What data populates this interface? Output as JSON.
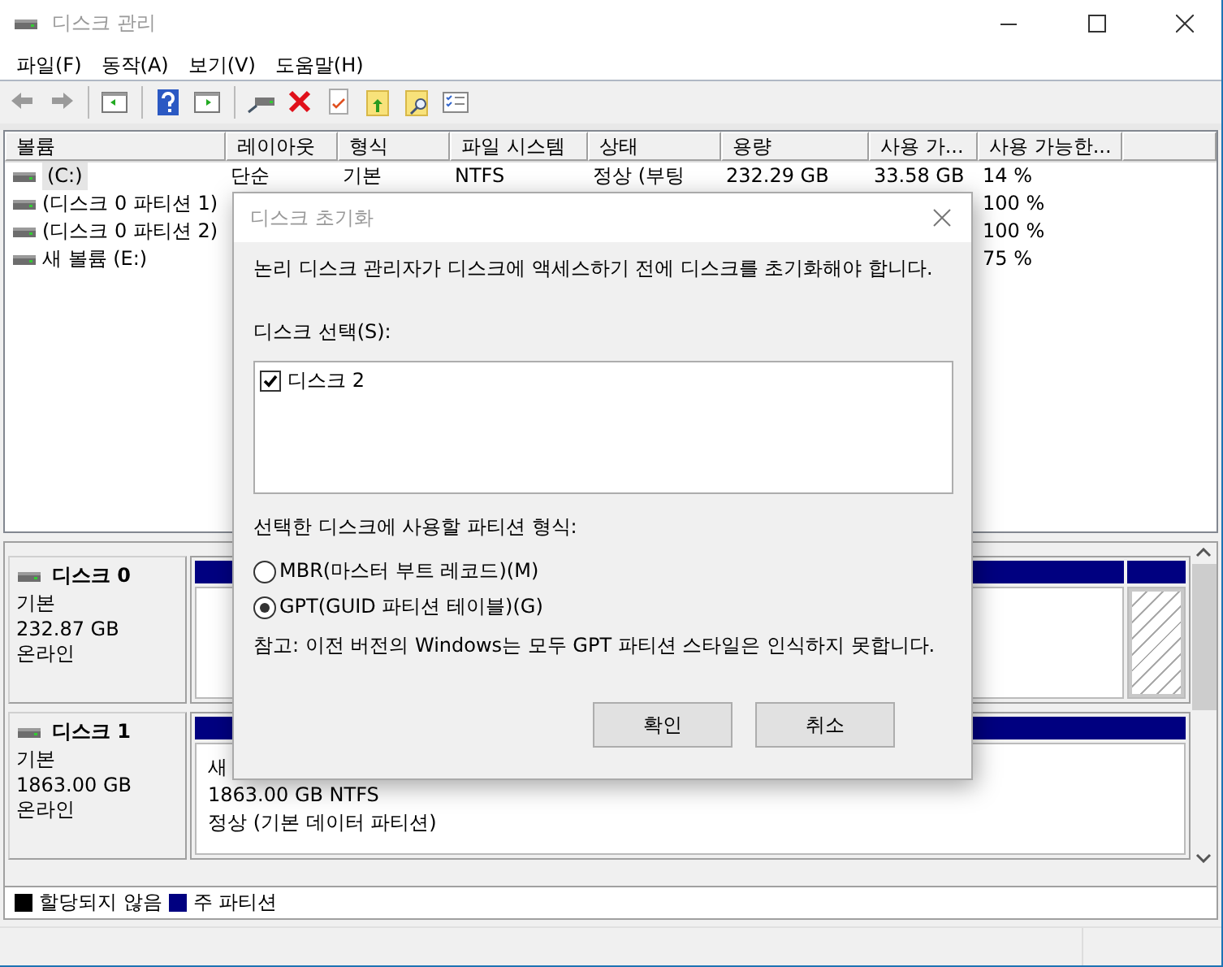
{
  "window": {
    "title": "디스크 관리"
  },
  "menu": [
    {
      "label": "파일(F)"
    },
    {
      "label": "동작(A)"
    },
    {
      "label": "보기(V)"
    },
    {
      "label": "도움말(H)"
    }
  ],
  "volumes": {
    "columns": [
      "볼륨",
      "레이아웃",
      "형식",
      "파일 시스템",
      "상태",
      "용량",
      "사용 가...",
      "사용 가능한..."
    ],
    "rows": [
      {
        "volume": "(C:)",
        "layout": "단순",
        "type": "기본",
        "file_system": "NTFS",
        "status": "정상 (부팅",
        "capacity": "232.29 GB",
        "free_space": "33.58 GB",
        "percent_free": "14 %",
        "selected": true
      },
      {
        "volume": "(디스크 0 파티션 1)",
        "percent_free": "100 %",
        "selected": false
      },
      {
        "volume": "(디스크 0 파티션 2)",
        "percent_free": "100 %",
        "selected": false
      },
      {
        "volume": "새 볼륨 (E:)",
        "percent_free": "75 %",
        "selected": false
      }
    ]
  },
  "disks": [
    {
      "name": "디스크 0",
      "type": "기본",
      "size": "232.87 GB",
      "status": "온라인",
      "partitions": [
        {
          "kind": "primary",
          "selected": false
        },
        {
          "kind": "primary",
          "selected": true
        }
      ]
    },
    {
      "name": "디스크 1",
      "type": "기본",
      "size": "1863.00 GB",
      "status": "온라인",
      "partitions": [
        {
          "kind": "primary",
          "selected": false,
          "lines": [
            "새",
            "1863.00 GB NTFS",
            "정상 (기본 데이터 파티션)"
          ]
        }
      ]
    }
  ],
  "legend": [
    {
      "label": "할당되지 않음",
      "color": "#000000"
    },
    {
      "label": "주 파티션",
      "color": "#000080"
    }
  ],
  "dialog": {
    "title": "디스크 초기화",
    "message": "논리 디스크 관리자가 디스크에 액세스하기 전에 디스크를 초기화해야 합니다.",
    "select_label": "디스크 선택(S):",
    "disks": [
      {
        "label": "디스크 2",
        "checked": true
      }
    ],
    "style_label": "선택한 디스크에 사용할 파티션 형식:",
    "styles": [
      {
        "label": "MBR(마스터 부트 레코드)(M)",
        "selected": false
      },
      {
        "label": "GPT(GUID 파티션 테이블)(G)",
        "selected": true
      }
    ],
    "note": "참고: 이전 버전의 Windows는 모두 GPT 파티션 스타일은 인식하지 못합니다.",
    "buttons": [
      "확인",
      "취소"
    ]
  }
}
